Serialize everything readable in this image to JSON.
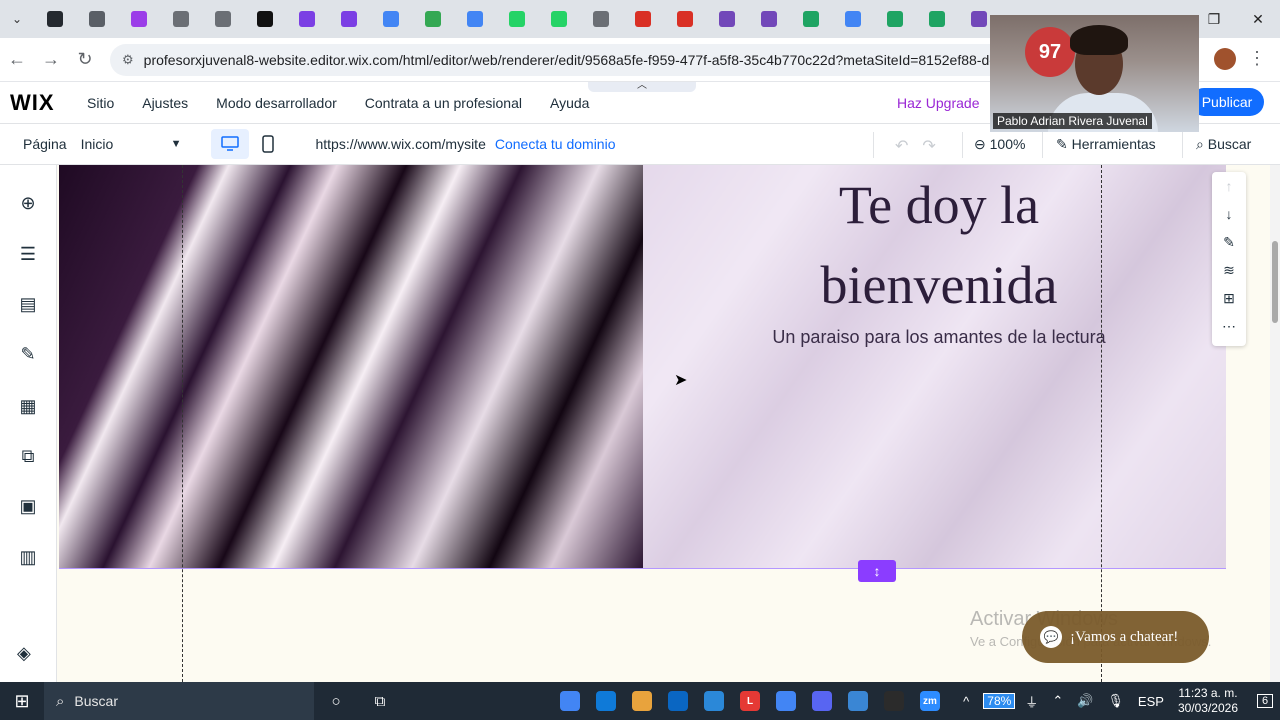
{
  "browser": {
    "url": "profesorxjuvenal8-website.editor.wix.com/html/editor/web/renderer/edit/9568a5fe-f959-477f-a5f8-35c4b770c22d?metaSiteId=8152ef88-dec1-4d",
    "tab_colors": [
      "#24292f",
      "#5a5f66",
      "#9b3ee8",
      "#6b6f75",
      "#6b6f75",
      "#111111",
      "#7b3fe4",
      "#7b3fe4",
      "#4285f4",
      "#34a853",
      "#4285f4",
      "#25d366",
      "#25d366",
      "#6b6f75",
      "#d93025",
      "#d93025",
      "#7248b9",
      "#7248b9",
      "#1fa463",
      "#4285f4",
      "#1fa463",
      "#1fa463",
      "#7248b9"
    ]
  },
  "wix": {
    "logo": "WIX",
    "menu": [
      "Sitio",
      "Ajustes",
      "Modo desarrollador",
      "Contrata a un profesional",
      "Ayuda"
    ],
    "upgrade": "Haz Upgrade",
    "publish": "Publicar",
    "page_label": "Página",
    "page_value": "Inicio",
    "site_url": "https://www.wix.com/mysite",
    "connect_domain": "Conecta tu dominio",
    "zoom": "100%",
    "tools": "Herramientas",
    "search": "Buscar",
    "accent": "#116dff",
    "upgrade_color": "#9a27d5"
  },
  "hero": {
    "title": "Te doy la bienvenida",
    "subtitle": "Un paraiso para los amantes de la lectura"
  },
  "chat": {
    "label": "¡Vamos a chatear!"
  },
  "watermark": {
    "title": "Activar Windows",
    "subtitle": "Ve a Configuración para activar Windows."
  },
  "webcam": {
    "name": "Pablo Adrian Rivera Juvenal",
    "sign": "97"
  },
  "taskbar": {
    "search": "Buscar",
    "battery": "78%",
    "lang": "ESP",
    "time": "11:23 a. m.",
    "date": "30/03/2026",
    "notifications": "6",
    "app_colors": [
      "#4285f4",
      "#0f7ad8",
      "#e8a33d",
      "#0a66c2",
      "#2b88d8",
      "#e53935",
      "#4285f4",
      "#5865f2",
      "#3a86d4",
      "#2b2b2b",
      "#2d8cff"
    ],
    "app_labels": [
      "",
      "",
      "",
      "",
      "",
      "L",
      "",
      "",
      "",
      "",
      "zm"
    ]
  }
}
